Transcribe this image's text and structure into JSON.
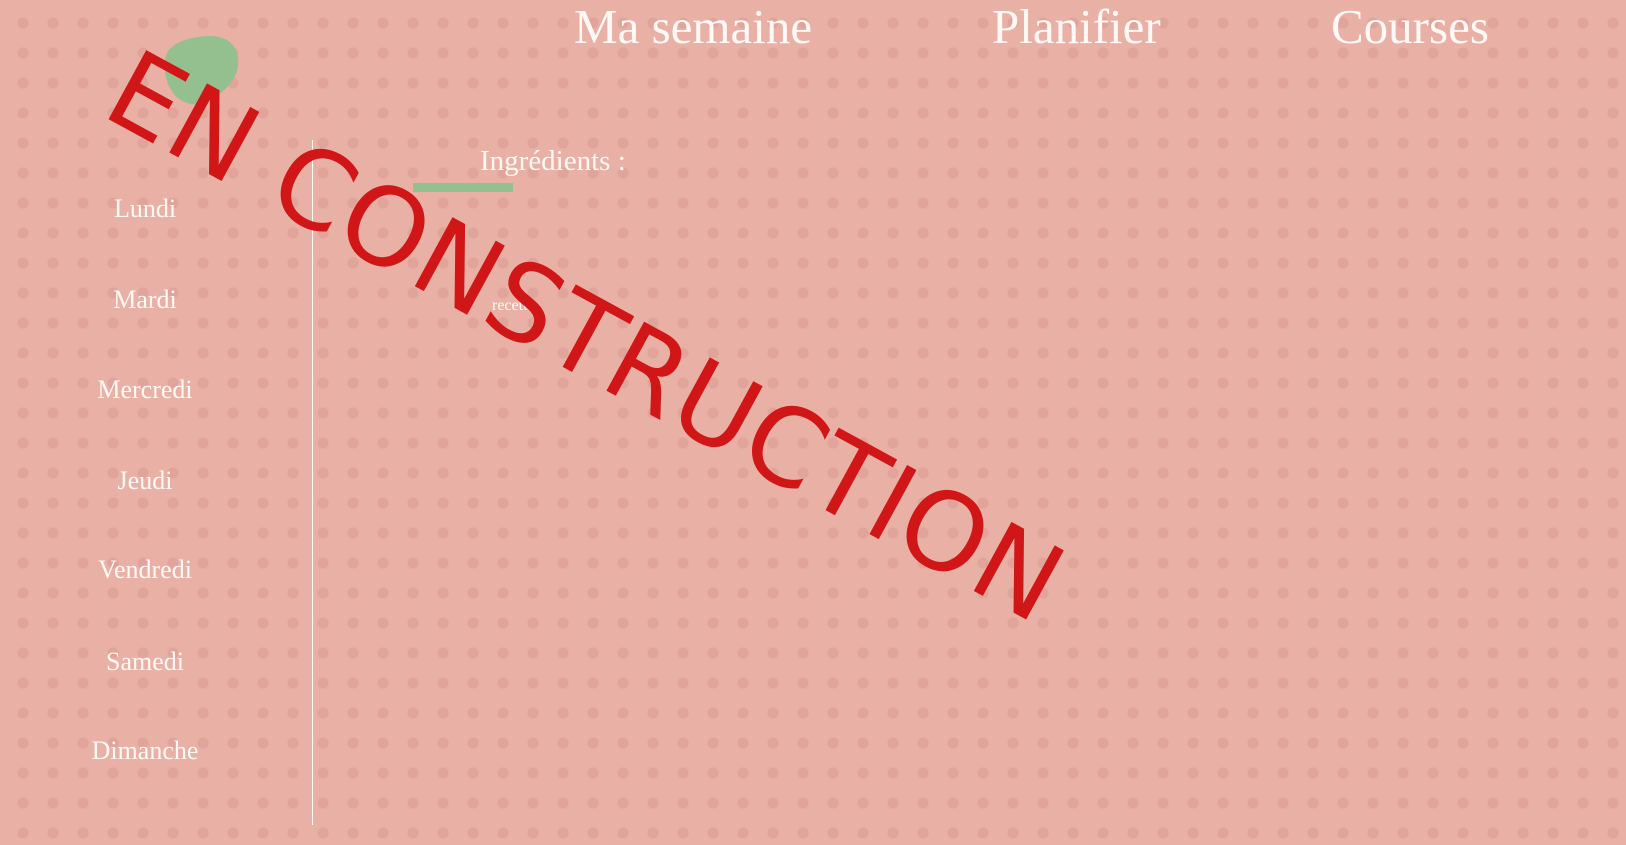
{
  "nav": {
    "items": [
      {
        "label": "Ma semaine"
      },
      {
        "label": "Planifier"
      },
      {
        "label": "Courses"
      }
    ]
  },
  "logo": {
    "icon": "green-blob-logo",
    "color": "#94bf8e"
  },
  "sidebar": {
    "days": [
      {
        "label": "Lundi"
      },
      {
        "label": "Mardi"
      },
      {
        "label": "Mercredi"
      },
      {
        "label": "Jeudi"
      },
      {
        "label": "Vendredi"
      },
      {
        "label": "Samedi"
      },
      {
        "label": "Dimanche"
      }
    ]
  },
  "main": {
    "ingredients_title": "Ingrédients :",
    "recipe_link": "recette"
  },
  "watermark": {
    "text": "EN CONSTRUCTION",
    "color": "#d01616"
  },
  "colors": {
    "background": "#e9b0a6",
    "accent_green": "#94bf8e",
    "text": "#fff8f4"
  }
}
